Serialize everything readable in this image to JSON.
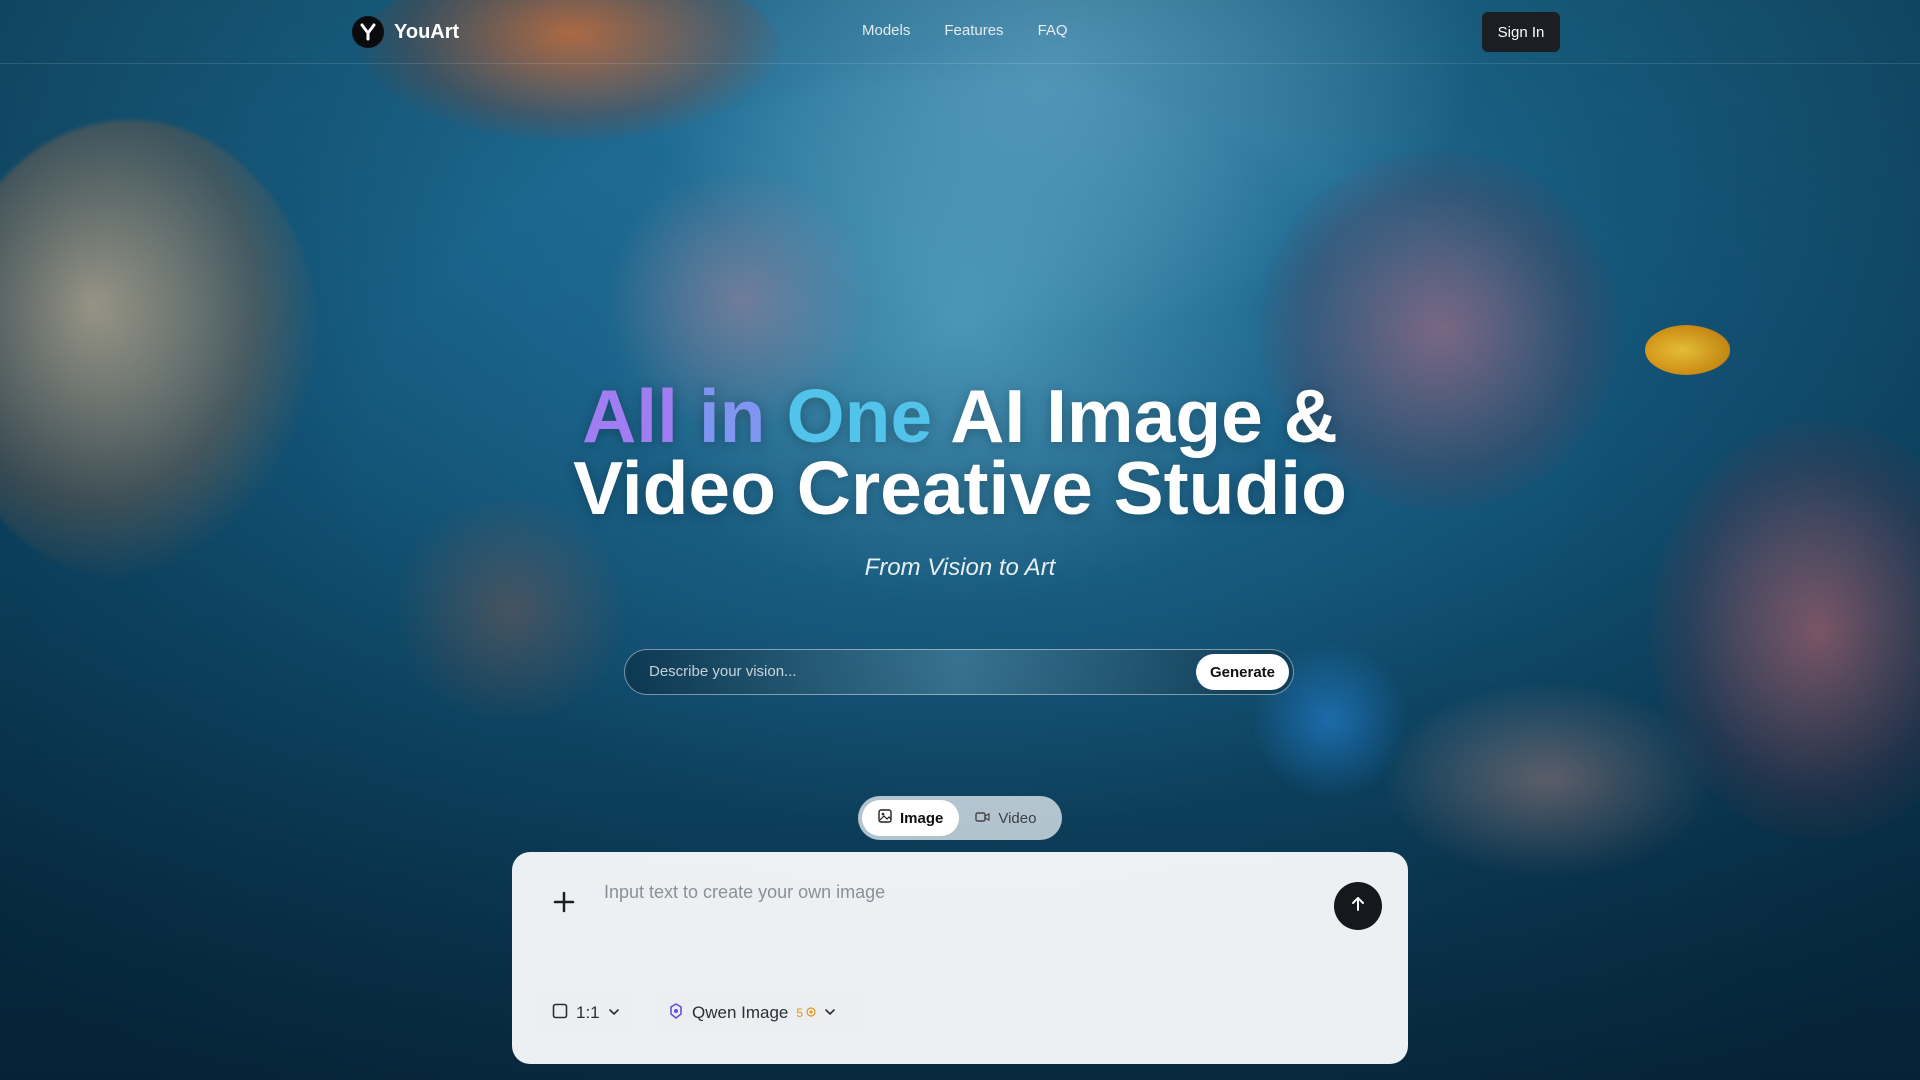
{
  "header": {
    "brand": "YouArt",
    "nav": [
      "Models",
      "Features",
      "FAQ"
    ],
    "signin_label": "Sign In"
  },
  "hero": {
    "title_gradient_words": [
      "All",
      "in",
      "One"
    ],
    "title_rest_line1": "AI Image &",
    "title_line2": "Video Creative Studio",
    "subtitle": "From Vision to Art"
  },
  "prompt": {
    "placeholder": "Describe your vision...",
    "generate_label": "Generate"
  },
  "modes": {
    "active": "Image",
    "image_label": "Image",
    "video_label": "Video"
  },
  "composer": {
    "placeholder": "Input text to create your own image",
    "aspect_ratio": "1:1",
    "model": "Qwen Image",
    "model_credits": "5"
  },
  "colors": {
    "gradient_start": "#a07ef2",
    "gradient_mid": "#7f95f0",
    "gradient_end": "#52c4ea",
    "credit_accent": "#e49314"
  }
}
